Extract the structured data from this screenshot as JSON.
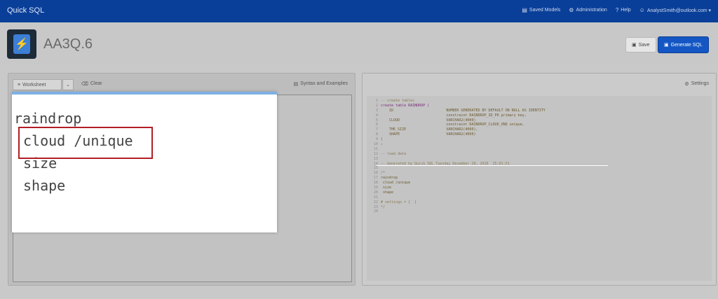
{
  "topbar": {
    "brand": "Quick SQL",
    "nav": [
      {
        "icon": "saved-models-icon",
        "glyph": "▤",
        "label": "Saved Models"
      },
      {
        "icon": "administration-icon",
        "glyph": "⚙",
        "label": "Administration"
      },
      {
        "icon": "help-icon",
        "glyph": "?",
        "label": "Help"
      },
      {
        "icon": "user-icon",
        "glyph": "☺",
        "label": "AnalystSmith@outlook.com ▾"
      }
    ]
  },
  "header": {
    "title": "AA3Q.6",
    "save_label": "Save",
    "generate_label": "Generate SQL"
  },
  "left_toolbar": {
    "worksheet_label": "Worksheet",
    "clear_label": "Clear",
    "syntax_label": "Syntax and Examples"
  },
  "right_toolbar": {
    "settings_label": "Settings"
  },
  "zoom_lines": [
    "raindrop",
    "cloud /unique",
    "size",
    "shape"
  ],
  "code_lines": [
    "-- create tables",
    "create table RAINDROP (",
    "    ID                         NUMBER GENERATED BY DEFAULT ON NULL AS IDENTITY",
    "                               constraint RAINDROP_ID_PK primary key,",
    "    CLOUD                      VARCHAR2(4000)",
    "                               constraint RAINDROP_CLOUD_UNQ unique,",
    "    THE_SIZE                   VARCHAR2(4000),",
    "    SHAPE                      VARCHAR2(4000)",
    ")",
    ";",
    "",
    "-- load data",
    "",
    "-- Generated by Quick SQL Tuesday December 20, 2016  15:01:51",
    "",
    "/*",
    "raindrop",
    " cloud /unique",
    " size",
    " shape",
    "",
    "# settings = {  }",
    "*/",
    ""
  ],
  "colors": {
    "topbar": "#0a3f99",
    "primary_button": "#1457c4",
    "highlight_border": "#b21e25"
  }
}
